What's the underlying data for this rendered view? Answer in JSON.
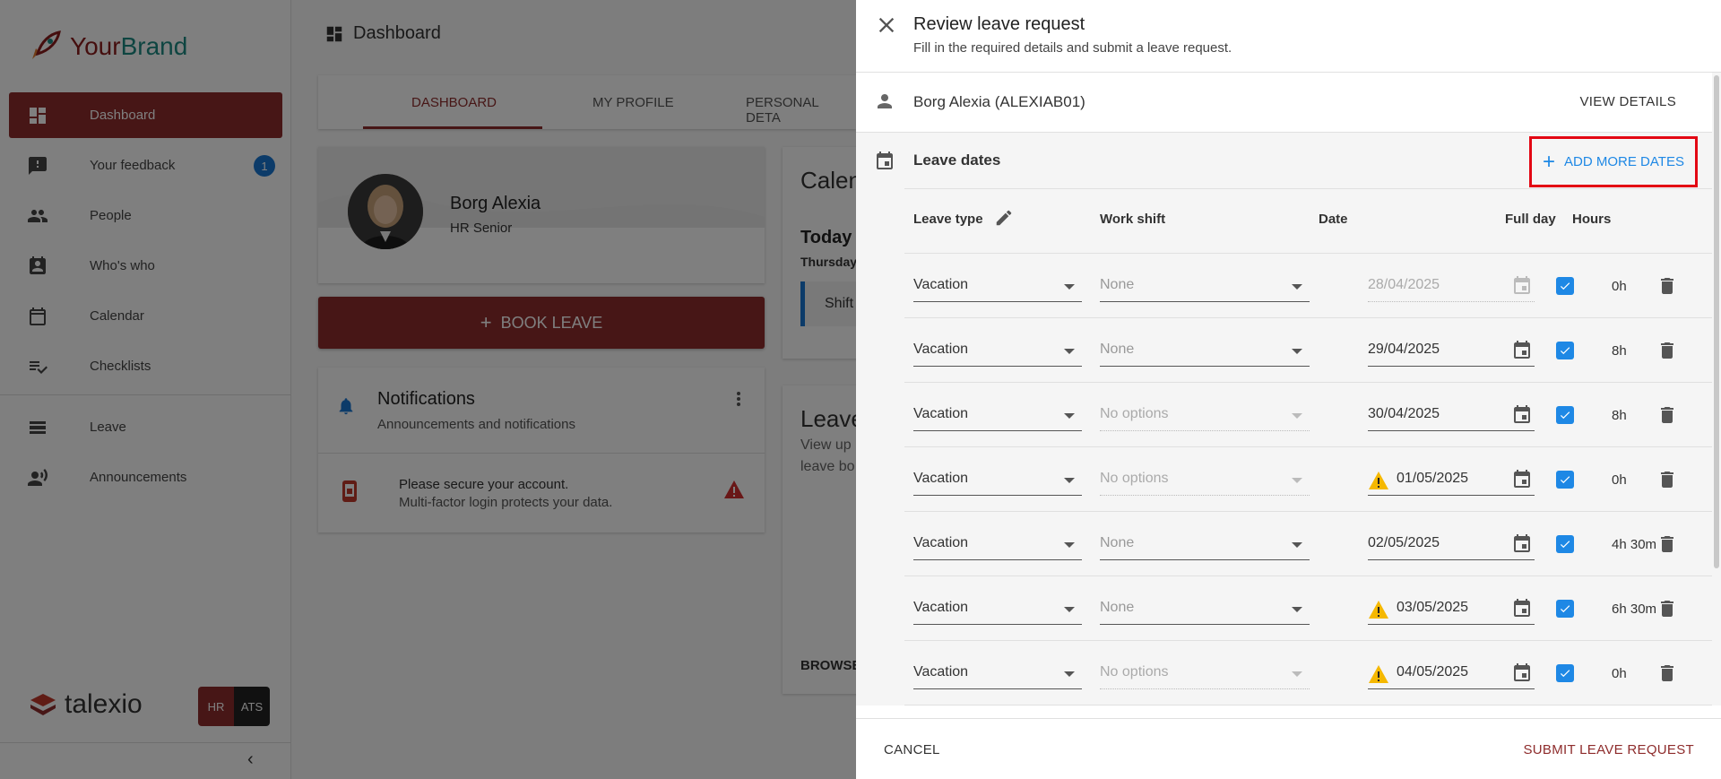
{
  "brand": {
    "name_part1": "Your",
    "name_part2": "Brand"
  },
  "sidebar": {
    "items": [
      {
        "label": "Dashboard",
        "icon": "dashboard-icon",
        "active": true
      },
      {
        "label": "Your feedback",
        "icon": "feedback-icon",
        "badge": "1"
      },
      {
        "label": "People",
        "icon": "people-icon"
      },
      {
        "label": "Who's who",
        "icon": "badge-icon"
      },
      {
        "label": "Calendar",
        "icon": "calendar-icon"
      },
      {
        "label": "Checklists",
        "icon": "checklist-icon"
      },
      {
        "label": "Leave",
        "icon": "leave-icon"
      },
      {
        "label": "Announcements",
        "icon": "announcement-icon"
      }
    ],
    "footer_logo": "talexio",
    "switch": {
      "hr": "HR",
      "ats": "ATS"
    }
  },
  "main": {
    "title": "Dashboard",
    "tabs": [
      "DASHBOARD",
      "MY PROFILE",
      "PERSONAL DETA"
    ],
    "profile": {
      "name": "Borg Alexia",
      "role": "HR Senior"
    },
    "book_leave": "BOOK LEAVE",
    "notifications": {
      "title": "Notifications",
      "subtitle": "Announcements and notifications",
      "message_title": "Please secure your account.",
      "message_body": "Multi-factor login protects your data."
    },
    "calendar_card": {
      "title": "Calen",
      "today": "Today",
      "day": "Thursday",
      "shift": "Shift"
    },
    "leave_card": {
      "title": "Leave",
      "line1": "View up",
      "line2": "leave bo",
      "browse": "BROWSE"
    }
  },
  "drawer": {
    "title": "Review leave request",
    "subtitle": "Fill in the required details and submit a leave request.",
    "employee": "Borg Alexia (ALEXIAB01)",
    "view_details": "VIEW DETAILS",
    "section_title": "Leave dates",
    "add_more_dates": "ADD MORE DATES",
    "headers": {
      "leave_type": "Leave type",
      "work_shift": "Work shift",
      "date": "Date",
      "full_day": "Full day",
      "hours": "Hours"
    },
    "rows": [
      {
        "leave_type": "Vacation",
        "work_shift": "None",
        "date": "28/04/2025",
        "hours": "0h",
        "shift_state": "none",
        "date_disabled": true,
        "warning": false
      },
      {
        "leave_type": "Vacation",
        "work_shift": "None",
        "date": "29/04/2025",
        "hours": "8h",
        "shift_state": "none",
        "date_disabled": false,
        "warning": false
      },
      {
        "leave_type": "Vacation",
        "work_shift": "No options",
        "date": "30/04/2025",
        "hours": "8h",
        "shift_state": "disabled",
        "date_disabled": false,
        "warning": false
      },
      {
        "leave_type": "Vacation",
        "work_shift": "No options",
        "date": "01/05/2025",
        "hours": "0h",
        "shift_state": "disabled",
        "date_disabled": false,
        "warning": true
      },
      {
        "leave_type": "Vacation",
        "work_shift": "None",
        "date": "02/05/2025",
        "hours": "4h 30m",
        "shift_state": "none",
        "date_disabled": false,
        "warning": false
      },
      {
        "leave_type": "Vacation",
        "work_shift": "None",
        "date": "03/05/2025",
        "hours": "6h 30m",
        "shift_state": "none",
        "date_disabled": false,
        "warning": true
      },
      {
        "leave_type": "Vacation",
        "work_shift": "No options",
        "date": "04/05/2025",
        "hours": "0h",
        "shift_state": "disabled",
        "date_disabled": false,
        "warning": true
      }
    ],
    "cancel": "CANCEL",
    "submit": "SUBMIT LEAVE REQUEST"
  },
  "colors": {
    "brand_red": "#8e2c2c",
    "accent_blue": "#1e88e5",
    "highlight_red": "#e30613",
    "warning_yellow": "#f5b800"
  }
}
